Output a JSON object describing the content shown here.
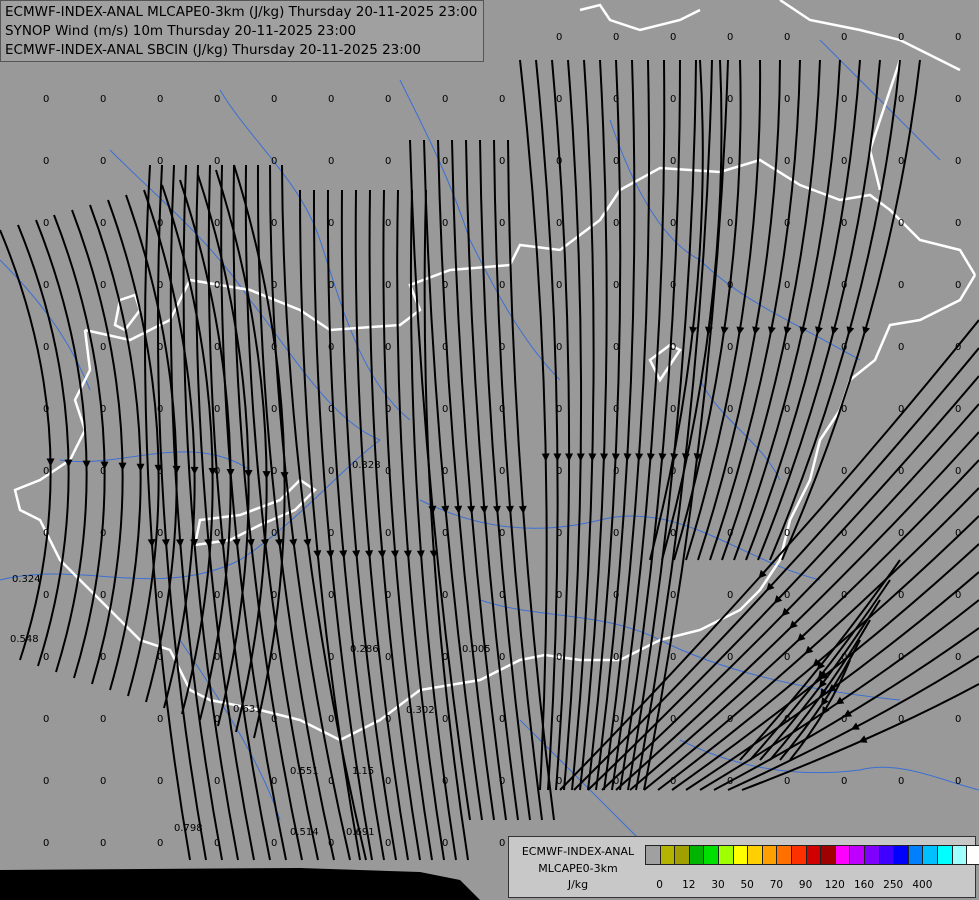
{
  "titles": [
    "ECMWF-INDEX-ANAL MLCAPE0-3km (J/kg) Thursday 20-11-2025 23:00",
    "SYNOP Wind (m/s) 10m Thursday 20-11-2025 23:00",
    "ECMWF-INDEX-ANAL SBCIN (J/kg) Thursday 20-11-2025 23:00"
  ],
  "legend": {
    "source": "ECMWF-INDEX-ANAL",
    "parameter": "MLCAPE0-3km",
    "unit": "J/kg",
    "colors": [
      "#a0a0a0",
      "#b4b400",
      "#a0a000",
      "#00b400",
      "#00e000",
      "#a0ff00",
      "#ffff00",
      "#ffd000",
      "#ffa000",
      "#ff7000",
      "#ff3000",
      "#d00000",
      "#a00000",
      "#ff00ff",
      "#c000ff",
      "#8000ff",
      "#4000ff",
      "#0000ff",
      "#0080ff",
      "#00c0ff",
      "#00ffff",
      "#a0ffff",
      "#ffffff"
    ],
    "ticks": [
      "0",
      "12",
      "30",
      "50",
      "70",
      "90",
      "120",
      "160",
      "250",
      "400"
    ]
  },
  "map": {
    "background": "#999999",
    "border_color": "#ffffff",
    "river_color": "#3b6fd4"
  },
  "values": [
    "0",
    "0",
    "0",
    "0",
    "0",
    "0",
    "0",
    "0",
    "0",
    "0",
    "0.324",
    "0.548",
    "0.328",
    "0.286",
    "0.005",
    "0.631",
    "0.302",
    "0.551",
    "1.15",
    "0.798",
    "0.514",
    "0.691"
  ]
}
